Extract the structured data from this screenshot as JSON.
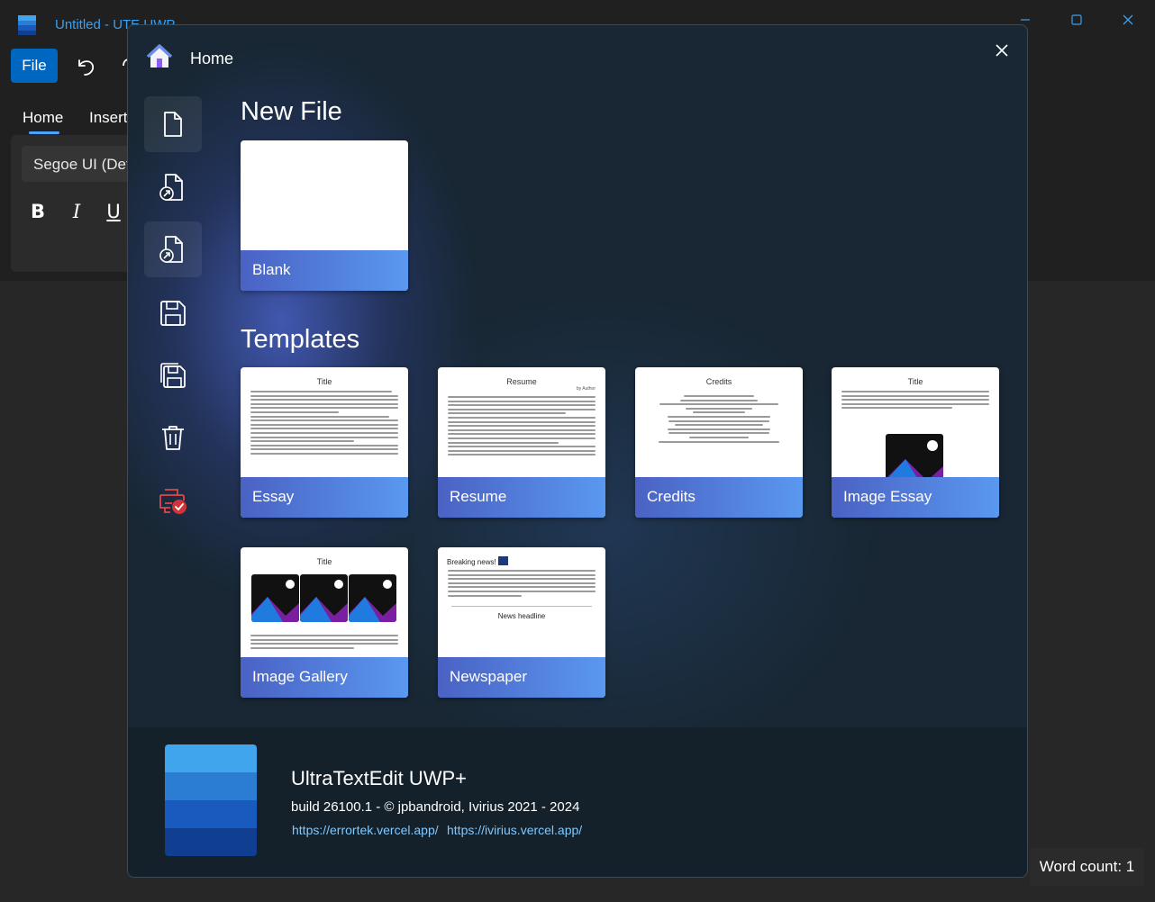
{
  "window": {
    "title": "Untitled - UTE UWP",
    "colors": {
      "accent": "#0067c0",
      "title_text": "#3aa0ef",
      "dialog_bg": "#182733"
    }
  },
  "toolbar": {
    "file_label": "File"
  },
  "ribbon": {
    "tabs": [
      "Home",
      "Insert"
    ],
    "font_name": "Segoe UI (Default)",
    "format": {
      "bold": "B",
      "italic": "I",
      "underline": "U"
    }
  },
  "status": {
    "word_count": "Word count: 1"
  },
  "dialog": {
    "title": "Home",
    "sidebar_icons": [
      "new-file-icon",
      "open-file-icon",
      "open-recent-icon",
      "save-icon",
      "save-as-icon",
      "delete-icon",
      "check-printer-icon"
    ],
    "new_file": {
      "heading": "New File",
      "blank_label": "Blank"
    },
    "templates": {
      "heading": "Templates",
      "items": [
        {
          "label": "Essay",
          "preview_title": "Title"
        },
        {
          "label": "Resume",
          "preview_title": "Resume",
          "preview_byline": "by Author"
        },
        {
          "label": "Credits",
          "preview_title": "Credits"
        },
        {
          "label": "Image Essay",
          "preview_title": "Title"
        },
        {
          "label": "Image Gallery",
          "preview_title": "Title"
        },
        {
          "label": "Newspaper",
          "preview_title": "Breaking news!",
          "preview_headline": "News headline"
        }
      ]
    },
    "footer": {
      "app_name": "UltraTextEdit UWP+",
      "build": "build 26100.1 - © jpbandroid, Ivirius 2021 - 2024",
      "links": [
        "https://errortek.vercel.app/",
        "https://ivirius.vercel.app/"
      ]
    }
  }
}
